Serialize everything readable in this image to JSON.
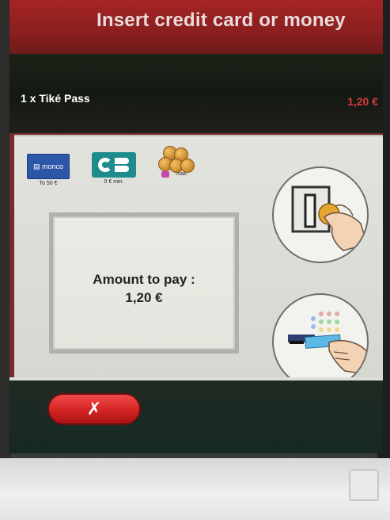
{
  "header": {
    "title": "Insert credit card or money"
  },
  "cart": {
    "item": "1 x Tiké Pass",
    "price": "1,20 €"
  },
  "payment_methods": [
    {
      "name": "monco-logo",
      "logo_text": "monco",
      "caption": "To 50 €"
    },
    {
      "name": "cb-card-logo",
      "logo_text": "",
      "caption": "0 € min."
    },
    {
      "name": "coins-logo",
      "logo_text": "",
      "caption": "max."
    }
  ],
  "amount": {
    "label": "Amount to pay :",
    "value": "1,20 €"
  },
  "cancel": {
    "label": "✗"
  },
  "colors": {
    "header_red": "#a52424",
    "price_red": "#d33b3b",
    "cancel_red": "#d42424",
    "cb_teal": "#1e8b8c",
    "monco_blue": "#2c57a8"
  }
}
